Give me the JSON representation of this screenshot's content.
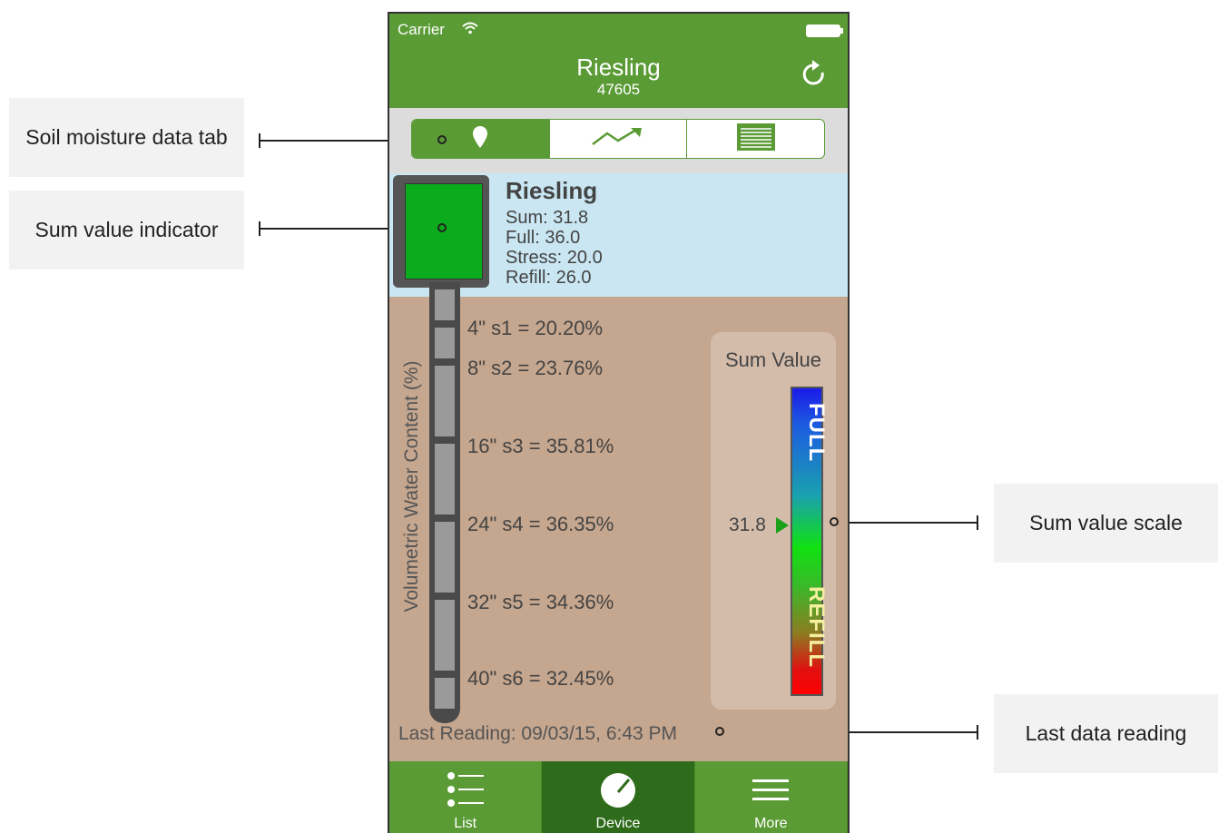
{
  "callouts": {
    "soil_tab": "Soil moisture data tab",
    "sum_indicator": "Sum value indicator",
    "sum_scale": "Sum value scale",
    "last_reading": "Last data reading"
  },
  "status_bar": {
    "carrier": "Carrier"
  },
  "nav": {
    "title": "Riesling",
    "subtitle": "47605",
    "refresh_icon": "refresh-icon"
  },
  "segments": [
    {
      "icon": "location-pin-icon",
      "selected": true
    },
    {
      "icon": "trend-chart-icon",
      "selected": false
    },
    {
      "icon": "table-icon",
      "selected": false
    }
  ],
  "summary": {
    "name": "Riesling",
    "sum": "Sum: 31.8",
    "full": "Full: 36.0",
    "stress": "Stress: 20.0",
    "refill": "Refill: 26.0"
  },
  "axis_label": "Volumetric Water Content (%)",
  "readings": [
    {
      "text": "4\"  s1 = 20.20%"
    },
    {
      "text": "8\"  s2 = 23.76%"
    },
    {
      "text": "16\"  s3 = 35.81%"
    },
    {
      "text": "24\"  s4 = 36.35%"
    },
    {
      "text": "32\"  s5 = 34.36%"
    },
    {
      "text": "40\"  s6 = 32.45%"
    }
  ],
  "scale": {
    "title": "Sum Value",
    "full_label": "FULL",
    "refill_label": "REFILL",
    "value": "31.8"
  },
  "last_reading": "Last Reading: 09/03/15, 6:43 PM",
  "tabs": [
    {
      "label": "List",
      "icon": "list-icon",
      "active": false
    },
    {
      "label": "Device",
      "icon": "gauge-icon",
      "active": true
    },
    {
      "label": "More",
      "icon": "menu-icon",
      "active": false
    }
  ],
  "colors": {
    "brand_green": "#5a9b35",
    "active_tab": "#2e6b1a",
    "soil": "#c5a68e",
    "summary_bg": "#c9e6f2"
  }
}
